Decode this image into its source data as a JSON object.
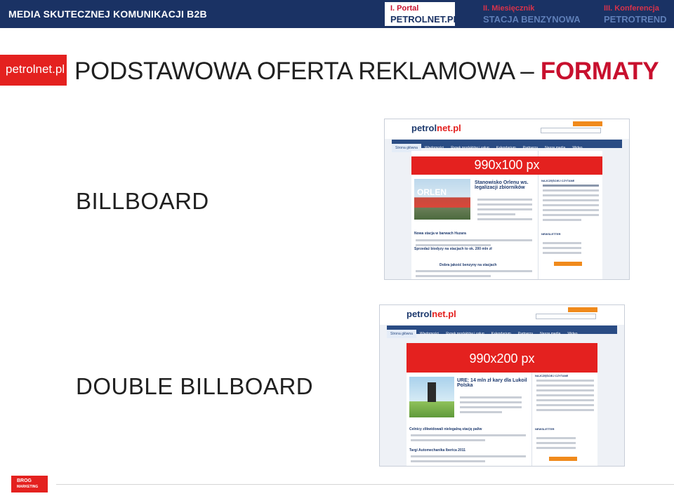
{
  "topbar": {
    "brand": "MEDIA SKUTECZNEJ KOMUNIKACJI B2B",
    "item1_a": "I. Portal",
    "item1_b": "PETROLNET.PL",
    "item2_a": "II. Miesięcznik",
    "item2_b": "STACJA BENZYNOWA",
    "item3_a": "III. Konferencja",
    "item3_b": "PETROTREND"
  },
  "logo": "petrolnet.pl",
  "title": {
    "main": "PODSTAWOWA OFERTA REKLAMOWA –",
    "accent": "FORMATY"
  },
  "formats": [
    {
      "label": "BILLBOARD",
      "ad_size": "990x100 px",
      "shot": {
        "logo_a": "petrol",
        "logo_b": "net.pl",
        "nav": [
          "Strona główna",
          "Wiadomości",
          "Rynek produktów i usług",
          "Kalendarium",
          "Partnerzy",
          "Nasze media",
          "Wideo"
        ],
        "orlen": "ORLEN",
        "headline": "Stanowisko Orlenu ws. legalizacji zbiorników",
        "story2": "Nowa stacja w barwach Huzara",
        "story3": "Sprzedaż biodyzy na stacjach to ok. 200 mln zł",
        "story4": "Dobra jakość benzyny na stacjach",
        "newsletter": "NEWSLETTER",
        "side_head": "NAJCZĘŚCIEJ CZYTANE"
      }
    },
    {
      "label": "DOUBLE BILLBOARD",
      "ad_size": "990x200 px",
      "shot": {
        "logo_a": "petrol",
        "logo_b": "net.pl",
        "nav": [
          "Strona główna",
          "Wiadomości",
          "Rynek produktów i usług",
          "Kalendarium",
          "Partnerzy",
          "Nasze media",
          "Wideo"
        ],
        "headline": "URE: 14 mln zł kary dla Lukoil Polska",
        "story2": "Celnicy zlikwidowali nielegalną stację paliw",
        "story3": "Targi Automechanika Iberica 2011",
        "newsletter": "NEWSLETTER",
        "side_head": "NAJCZĘŚCIEJ CZYTANE"
      }
    }
  ],
  "footer": {
    "brog_a": "BROG",
    "brog_b": "MARKETING"
  },
  "colors": {
    "navy": "#1a3264",
    "red": "#e4211f",
    "accent": "#c8102e"
  }
}
